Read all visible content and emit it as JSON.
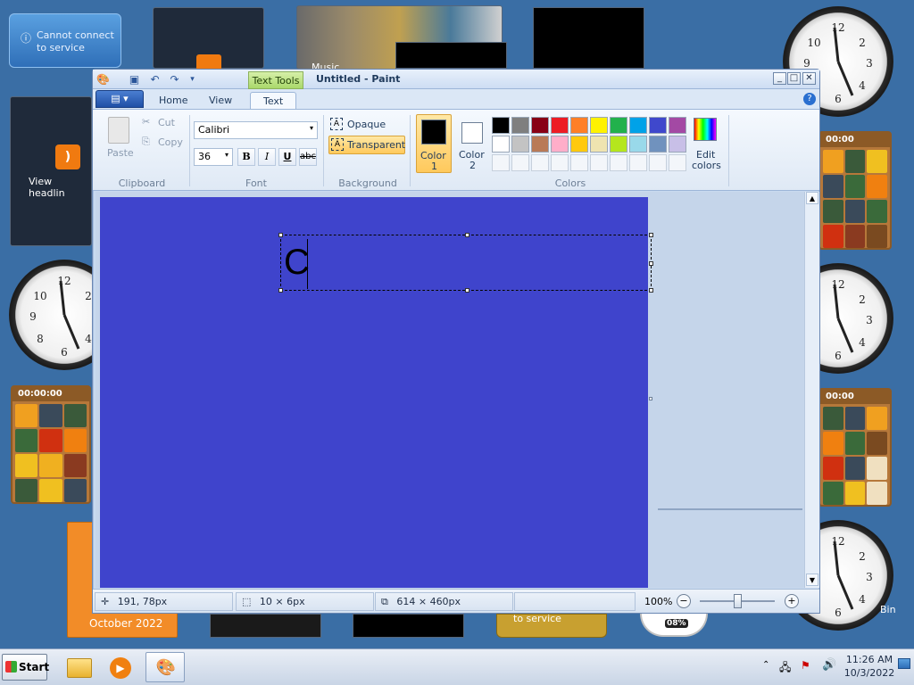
{
  "desktop": {
    "gadget_status": "Cannot connect to service",
    "gadget_status_bottom": "to service",
    "feed_button": "View headlin",
    "slideshow_label": "Music",
    "calendar_label": "October 2022",
    "puzzle_timer": "00:00:00",
    "puzzle_timer_short": "00:00",
    "bin_label": "Bin",
    "meter_value": "08%"
  },
  "paint": {
    "title": "Untitled - Paint",
    "context_tab": "Text Tools",
    "tabs": [
      "Home",
      "View",
      "Text"
    ],
    "clipboard": {
      "paste": "Paste",
      "cut": "Cut",
      "copy": "Copy",
      "label": "Clipboard"
    },
    "font": {
      "family": "Calibri",
      "size": "36",
      "bold": "B",
      "italic": "I",
      "underline": "U",
      "strike": "abc",
      "label": "Font"
    },
    "background": {
      "opaque": "Opaque",
      "transparent": "Transparent",
      "label": "Background"
    },
    "colors": {
      "color1_label": "Color",
      "color1_num": "1",
      "color2_label": "Color",
      "color2_num": "2",
      "edit_colors_1": "Edit",
      "edit_colors_2": "colors",
      "label": "Colors",
      "color1": "#000000",
      "color2": "#ffffff",
      "palette_row1": [
        "#000000",
        "#7f7f7f",
        "#880015",
        "#ed1c24",
        "#ff7f27",
        "#fff200",
        "#22b14c",
        "#00a2e8",
        "#3f48cc",
        "#a349a4"
      ],
      "palette_row2": [
        "#ffffff",
        "#c3c3c3",
        "#b97a57",
        "#ffaec9",
        "#ffc90e",
        "#efe4b0",
        "#b5e61d",
        "#99d9ea",
        "#7092be",
        "#c8bfe7"
      ]
    },
    "canvas_color": "#3f44cc",
    "text_box_content": "C",
    "status": {
      "cursor": "191, 78px",
      "selection": "10 × 6px",
      "image_size": "614 × 460px",
      "zoom": "100%"
    }
  },
  "taskbar": {
    "start": "Start",
    "time": "11:26 AM",
    "date": "10/3/2022"
  }
}
